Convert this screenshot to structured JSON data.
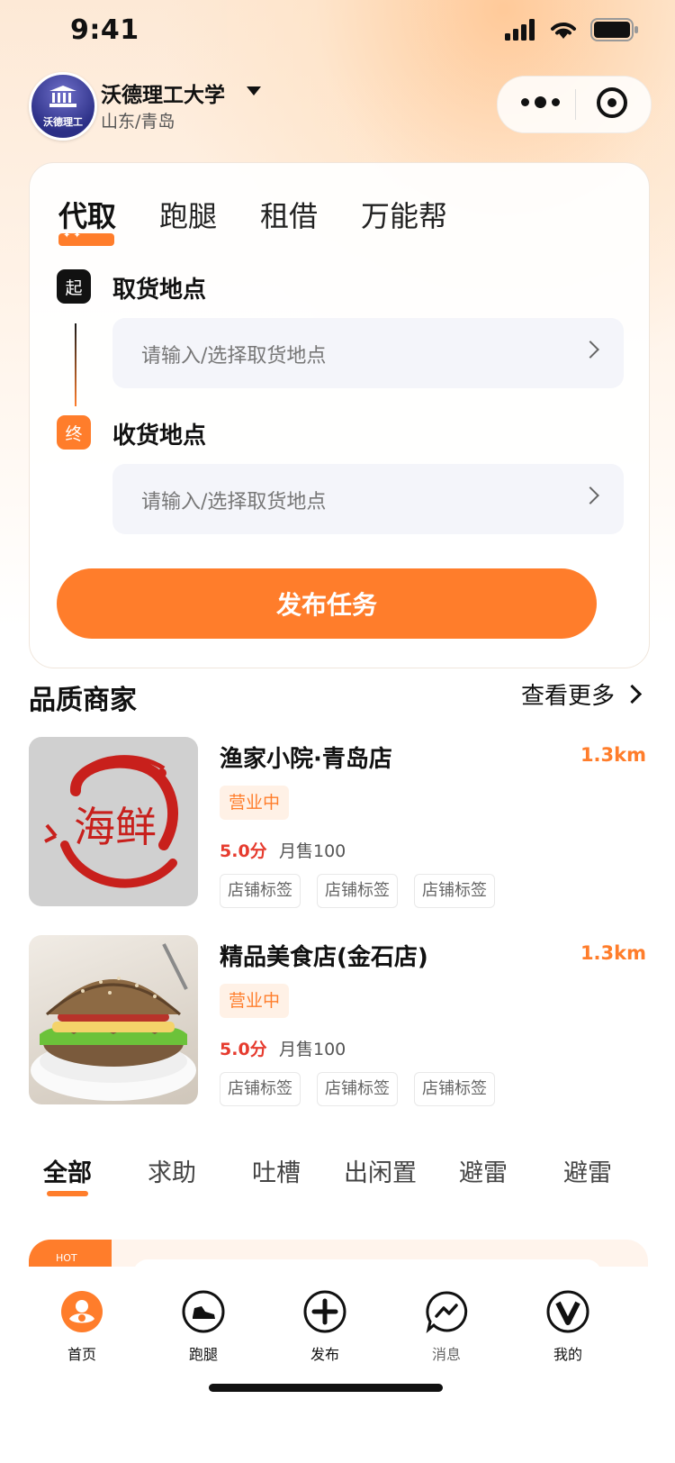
{
  "status_bar": {
    "time": "9:41"
  },
  "header": {
    "school_name": "沃德理工大学",
    "school_logo_text": "沃德理工",
    "location": "山东/青岛"
  },
  "service_tabs": [
    "代取",
    "跑腿",
    "租借",
    "万能帮"
  ],
  "route": {
    "start_badge": "起",
    "start_label": "取货地点",
    "start_placeholder": "请输入/选择取货地点",
    "end_badge": "终",
    "end_label": "收货地点",
    "end_placeholder": "请输入/选择取货地点",
    "publish_label": "发布任务"
  },
  "merchants_section": {
    "title": "品质商家",
    "more_label": "查看更多"
  },
  "merchants": [
    {
      "name": "渔家小院·青岛店",
      "distance": "1.3km",
      "status": "营业中",
      "score": "5.0分",
      "sales": "月售100",
      "tags": [
        "店铺标签",
        "店铺标签",
        "店铺标签"
      ],
      "image_text": "海鲜"
    },
    {
      "name": "精品美食店(金石店)",
      "distance": "1.3km",
      "status": "营业中",
      "score": "5.0分",
      "sales": "月售100",
      "tags": [
        "店铺标签",
        "店铺标签",
        "店铺标签"
      ]
    }
  ],
  "categories": [
    "全部",
    "求助",
    "吐槽",
    "出闲置",
    "避雷",
    "避雷"
  ],
  "hot_badge": "HOT",
  "tabbar": [
    {
      "label": "首页",
      "icon": "home-icon"
    },
    {
      "label": "跑腿",
      "icon": "sneaker-icon"
    },
    {
      "label": "发布",
      "icon": "plus-circle-icon"
    },
    {
      "label": "消息",
      "icon": "message-icon"
    },
    {
      "label": "我的",
      "icon": "profile-v-icon"
    }
  ],
  "colors": {
    "accent": "#ff7d2b",
    "score": "#e63b2e",
    "field_bg": "#f4f5fa"
  }
}
